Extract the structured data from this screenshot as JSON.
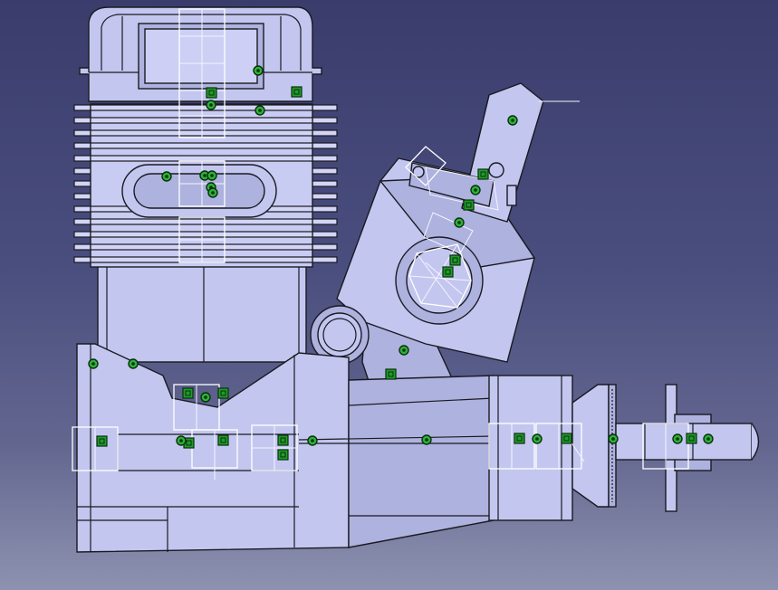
{
  "viewer": {
    "background_top": "#3a3d6c",
    "background_bottom": "#8e92b0",
    "model_fill": "#c3c7ef",
    "model_edge": "#1a1a22",
    "constraint_color": "#1f9c2a",
    "highlight_color": "#ffffff"
  },
  "model": {
    "parts": [
      "cylinder-head",
      "cooling-fins",
      "cylinder-barrel",
      "exhaust-port",
      "carburetor",
      "crankcase",
      "front-housing",
      "prop-hub",
      "prop-shaft"
    ],
    "constraint_marker_icon": "constraint-marker-icon",
    "anchor_ring_icon": "anchor-ring-icon",
    "selection_box_icon": "selection-box-icon"
  }
}
